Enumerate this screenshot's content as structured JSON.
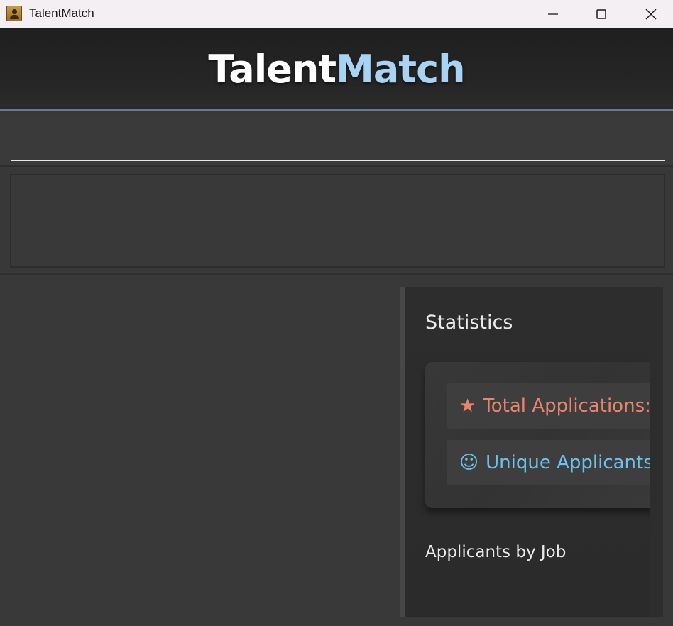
{
  "window": {
    "title": "TalentMatch"
  },
  "header": {
    "brand_part1": "Talent",
    "brand_part2": "Match"
  },
  "search": {
    "value": "",
    "placeholder": ""
  },
  "stats": {
    "title": "Statistics",
    "total_icon": "★",
    "total_label": "Total Applications:",
    "unique_icon": "☺",
    "unique_label": "Unique Applicants:",
    "by_job_title": "Applicants by Job"
  },
  "colors": {
    "accent_orange": "#e8866d",
    "accent_blue": "#6cc2ec",
    "brand_blue": "#a9d3f3",
    "header_border": "#5f7f95"
  }
}
